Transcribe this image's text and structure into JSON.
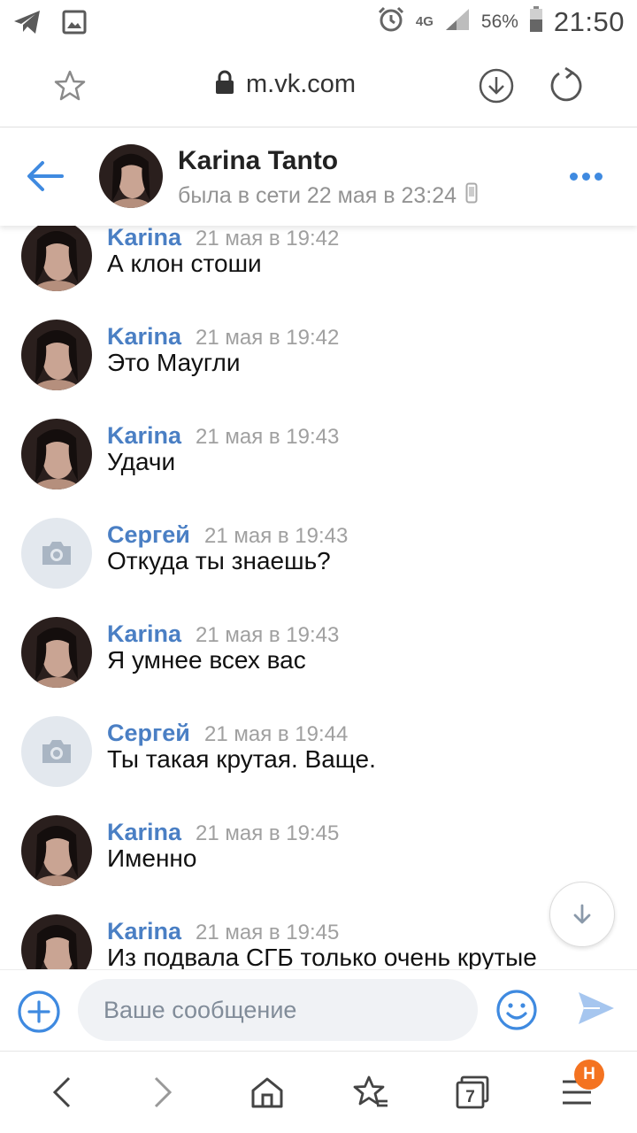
{
  "status_bar": {
    "time": "21:50",
    "battery_percent": "56%",
    "network": "4G",
    "icons": [
      "telegram-icon",
      "image-icon",
      "alarm-icon",
      "signal-icon",
      "battery-icon"
    ]
  },
  "browser": {
    "url": "m.vk.com",
    "icons": [
      "star-icon",
      "lock-icon",
      "download-icon",
      "reload-icon"
    ]
  },
  "chat_header": {
    "name": "Karina Tanto",
    "status": "была в сети 22 мая в 23:24",
    "icons": [
      "back-arrow-icon",
      "mobile-icon",
      "more-icon"
    ]
  },
  "messages": [
    {
      "author": "Karina",
      "time": "21 мая в 19:42",
      "text": "А клон стоши",
      "avatar": "photo"
    },
    {
      "author": "Karina",
      "time": "21 мая в 19:42",
      "text": "Это Маугли",
      "avatar": "photo"
    },
    {
      "author": "Karina",
      "time": "21 мая в 19:43",
      "text": "Удачи",
      "avatar": "photo"
    },
    {
      "author": "Сергей",
      "time": "21 мая в 19:43",
      "text": "Откуда ты знаешь?",
      "avatar": "camera"
    },
    {
      "author": "Karina",
      "time": "21 мая в 19:43",
      "text": "Я умнее всех вас",
      "avatar": "photo"
    },
    {
      "author": "Сергей",
      "time": "21 мая в 19:44",
      "text": "Ты такая крутая. Ваще.",
      "avatar": "camera"
    },
    {
      "author": "Karina",
      "time": "21 мая в 19:45",
      "text": "Именно",
      "avatar": "photo"
    },
    {
      "author": "Karina",
      "time": "21 мая в 19:45",
      "text": "Из подвала СГБ только очень крутые",
      "avatar": "photo"
    }
  ],
  "composer": {
    "placeholder": "Ваше сообщение",
    "icons": [
      "add-attachment-icon",
      "emoji-icon",
      "send-icon"
    ]
  },
  "bottom_nav": {
    "tabs_count": "7",
    "badge": "H",
    "icons": [
      "back-icon",
      "forward-icon",
      "home-icon",
      "bookmarks-icon",
      "tabs-icon",
      "menu-icon"
    ]
  },
  "colors": {
    "vk_blue": "#3f8ae0",
    "author_blue": "#4a7fc4",
    "time_gray": "#a0a0a0",
    "badge_orange": "#f47321"
  }
}
